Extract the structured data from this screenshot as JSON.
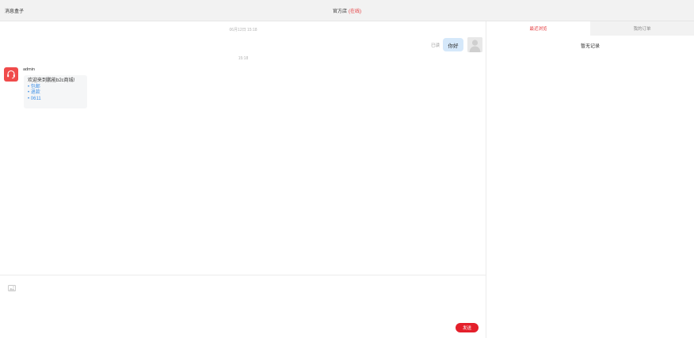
{
  "header": {
    "app_title": "消息盒子",
    "shop_name": "官方店",
    "shop_status": "(在线)"
  },
  "chat": {
    "timestamp_1": "06月12日 15:18",
    "timestamp_2": "15:18",
    "outgoing": {
      "read_status": "已读",
      "text": "你好"
    },
    "incoming": {
      "sender": "admin",
      "welcome": "欢迎来到鹏能b2c商城!",
      "links": [
        "• 包邮",
        "• 退款",
        "• 0611"
      ]
    }
  },
  "input": {
    "image_icon": "image-icon",
    "send_label": "发送"
  },
  "sidebar": {
    "tabs": [
      {
        "label": "最近浏览",
        "active": true
      },
      {
        "label": "我的订单",
        "active": false
      }
    ],
    "empty_text": "暂无记录"
  },
  "colors": {
    "accent_red": "#e4202b",
    "link_blue": "#3d8fe6",
    "bubble_blue": "#d5e8fa",
    "admin_avatar": "#f04b4b"
  }
}
